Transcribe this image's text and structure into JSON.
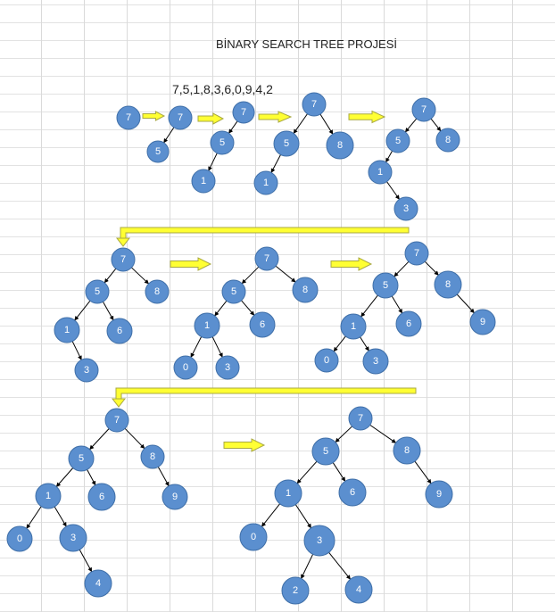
{
  "title": "BİNARY SEARCH TREE PROJESİ",
  "sequence": "7,5,1,8,3,6,0,9,4,2",
  "colors": {
    "node_fill": "#5b8fcf",
    "node_stroke": "#3f6fa8",
    "arrow_fill": "#ffff33",
    "arrow_stroke": "#a8a840",
    "edge": "#000000"
  },
  "steps": [
    {
      "nodes": [
        {
          "label": "7"
        }
      ]
    },
    {
      "nodes": [
        {
          "label": "7"
        },
        {
          "label": "5"
        }
      ]
    },
    {
      "nodes": [
        {
          "label": "7"
        },
        {
          "label": "5"
        },
        {
          "label": "1"
        }
      ]
    },
    {
      "nodes": [
        {
          "label": "7"
        },
        {
          "label": "5"
        },
        {
          "label": "8"
        },
        {
          "label": "1"
        }
      ]
    },
    {
      "nodes": [
        {
          "label": "7"
        },
        {
          "label": "5"
        },
        {
          "label": "8"
        },
        {
          "label": "1"
        },
        {
          "label": "3"
        }
      ]
    },
    {
      "nodes": [
        {
          "label": "7"
        },
        {
          "label": "5"
        },
        {
          "label": "8"
        },
        {
          "label": "1"
        },
        {
          "label": "6"
        },
        {
          "label": "3"
        }
      ]
    },
    {
      "nodes": [
        {
          "label": "7"
        },
        {
          "label": "5"
        },
        {
          "label": "8"
        },
        {
          "label": "1"
        },
        {
          "label": "6"
        },
        {
          "label": "0"
        },
        {
          "label": "3"
        }
      ]
    },
    {
      "nodes": [
        {
          "label": "7"
        },
        {
          "label": "5"
        },
        {
          "label": "8"
        },
        {
          "label": "1"
        },
        {
          "label": "6"
        },
        {
          "label": "9"
        },
        {
          "label": "0"
        },
        {
          "label": "3"
        }
      ]
    },
    {
      "nodes": [
        {
          "label": "7"
        },
        {
          "label": "5"
        },
        {
          "label": "8"
        },
        {
          "label": "1"
        },
        {
          "label": "6"
        },
        {
          "label": "9"
        },
        {
          "label": "0"
        },
        {
          "label": "3"
        },
        {
          "label": "4"
        }
      ]
    },
    {
      "nodes": [
        {
          "label": "7"
        },
        {
          "label": "5"
        },
        {
          "label": "8"
        },
        {
          "label": "1"
        },
        {
          "label": "6"
        },
        {
          "label": "9"
        },
        {
          "label": "0"
        },
        {
          "label": "3"
        },
        {
          "label": "2"
        },
        {
          "label": "4"
        }
      ]
    }
  ]
}
